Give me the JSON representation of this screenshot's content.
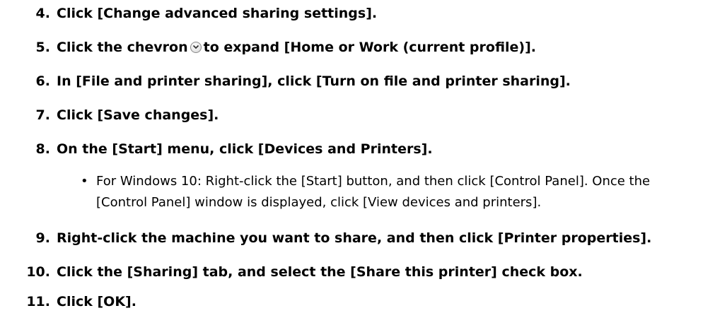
{
  "steps": [
    {
      "num": "4.",
      "text": "Click [Change advanced sharing settings]."
    },
    {
      "num": "5.",
      "text_before": "Click the chevron",
      "icon": "chevron-down-icon",
      "text_after": "to expand [Home or Work (current profile)]."
    },
    {
      "num": "6.",
      "text": "In [File and printer sharing], click [Turn on file and printer sharing]."
    },
    {
      "num": "7.",
      "text": "Click [Save changes]."
    },
    {
      "num": "8.",
      "text": "On the [Start] menu, click [Devices and Printers]."
    },
    {
      "num": "9.",
      "text": "Right-click the machine you want to share, and then click [Printer properties]."
    },
    {
      "num": "10.",
      "text": "Click the [Sharing] tab, and select the [Share this printer] check box."
    },
    {
      "num": "11.",
      "text": "Click [OK]."
    }
  ],
  "note": {
    "bullet": "•",
    "text": "For Windows 10: Right-click the [Start] button, and then click [Control Panel]. Once the [Control Panel] window is displayed, click [View devices and printers]."
  }
}
